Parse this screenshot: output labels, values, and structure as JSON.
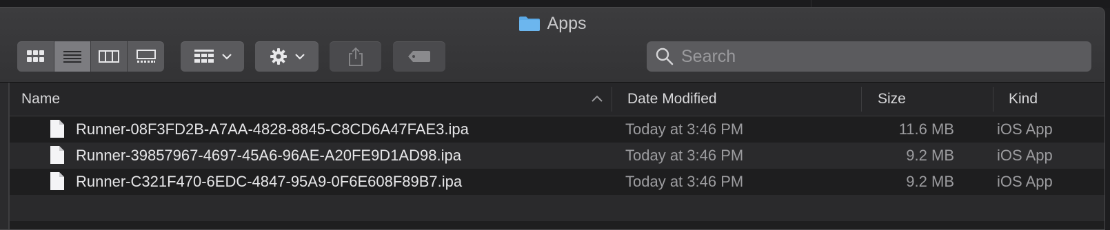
{
  "window": {
    "title": "Apps"
  },
  "toolbar": {
    "view_modes": [
      "icon-view",
      "list-view",
      "column-view",
      "gallery-view"
    ],
    "active_view": "list-view",
    "group_button": "group-by-icon",
    "action_button": "gear-icon",
    "share_button": "share-icon",
    "tag_button": "tag-icon"
  },
  "search": {
    "placeholder": "Search",
    "value": ""
  },
  "columns": {
    "name": "Name",
    "date": "Date Modified",
    "size": "Size",
    "kind": "Kind"
  },
  "files": [
    {
      "name": "Runner-08F3FD2B-A7AA-4828-8845-C8CD6A47FAE3.ipa",
      "date": "Today at 3:46 PM",
      "size": "11.6 MB",
      "kind": "iOS App"
    },
    {
      "name": "Runner-39857967-4697-45A6-96AE-A20FE9D1AD98.ipa",
      "date": "Today at 3:46 PM",
      "size": "9.2 MB",
      "kind": "iOS App"
    },
    {
      "name": "Runner-C321F470-6EDC-4847-95A9-0F6E608F89B7.ipa",
      "date": "Today at 3:46 PM",
      "size": "9.2 MB",
      "kind": "iOS App"
    }
  ],
  "colors": {
    "accent_folder": "#5aa9e6",
    "background": "#1e1e1f",
    "toolbar": "#363638"
  }
}
